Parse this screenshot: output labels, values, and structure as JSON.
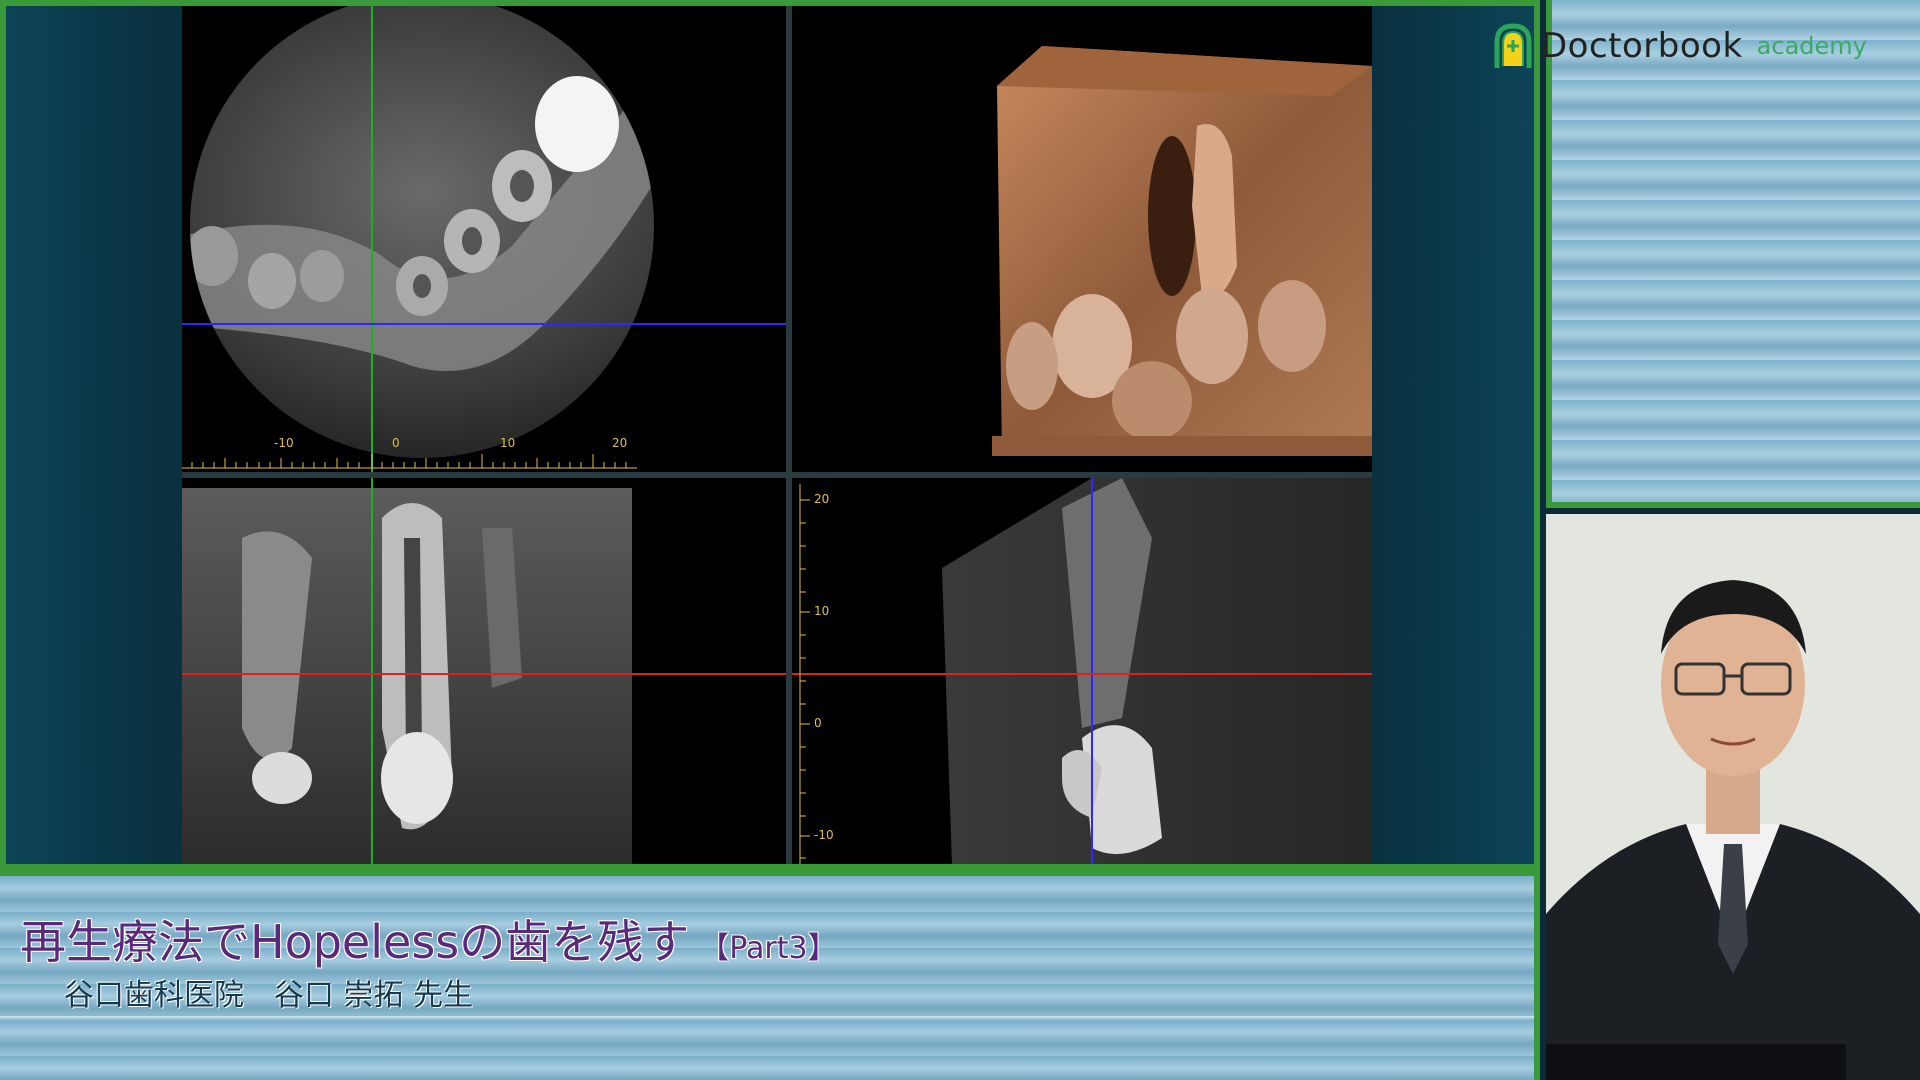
{
  "logo": {
    "word": "Doctorbook",
    "sub": "academy",
    "icon": "doctorbook-shield-icon",
    "colors": {
      "brand_green": "#3caa64",
      "frame_green": "#3a9a3a"
    }
  },
  "ct_viewer": {
    "axial_ruler_labels": [
      "-10",
      "0",
      "10",
      "20"
    ],
    "sagittal_ruler_labels": [
      "20",
      "10",
      "0",
      "-10"
    ],
    "crosshair_colors": {
      "vertical": "#1fae2a",
      "horizontal_top": "#2a2aff",
      "horizontal_bottom": "#e02020",
      "sagittal_vertical": "#2a2aff"
    }
  },
  "caption": {
    "title": "再生療法でHopelessの歯を残す",
    "part": "【Part3】",
    "speaker": "谷口歯科医院　谷口 崇拓 先生"
  }
}
